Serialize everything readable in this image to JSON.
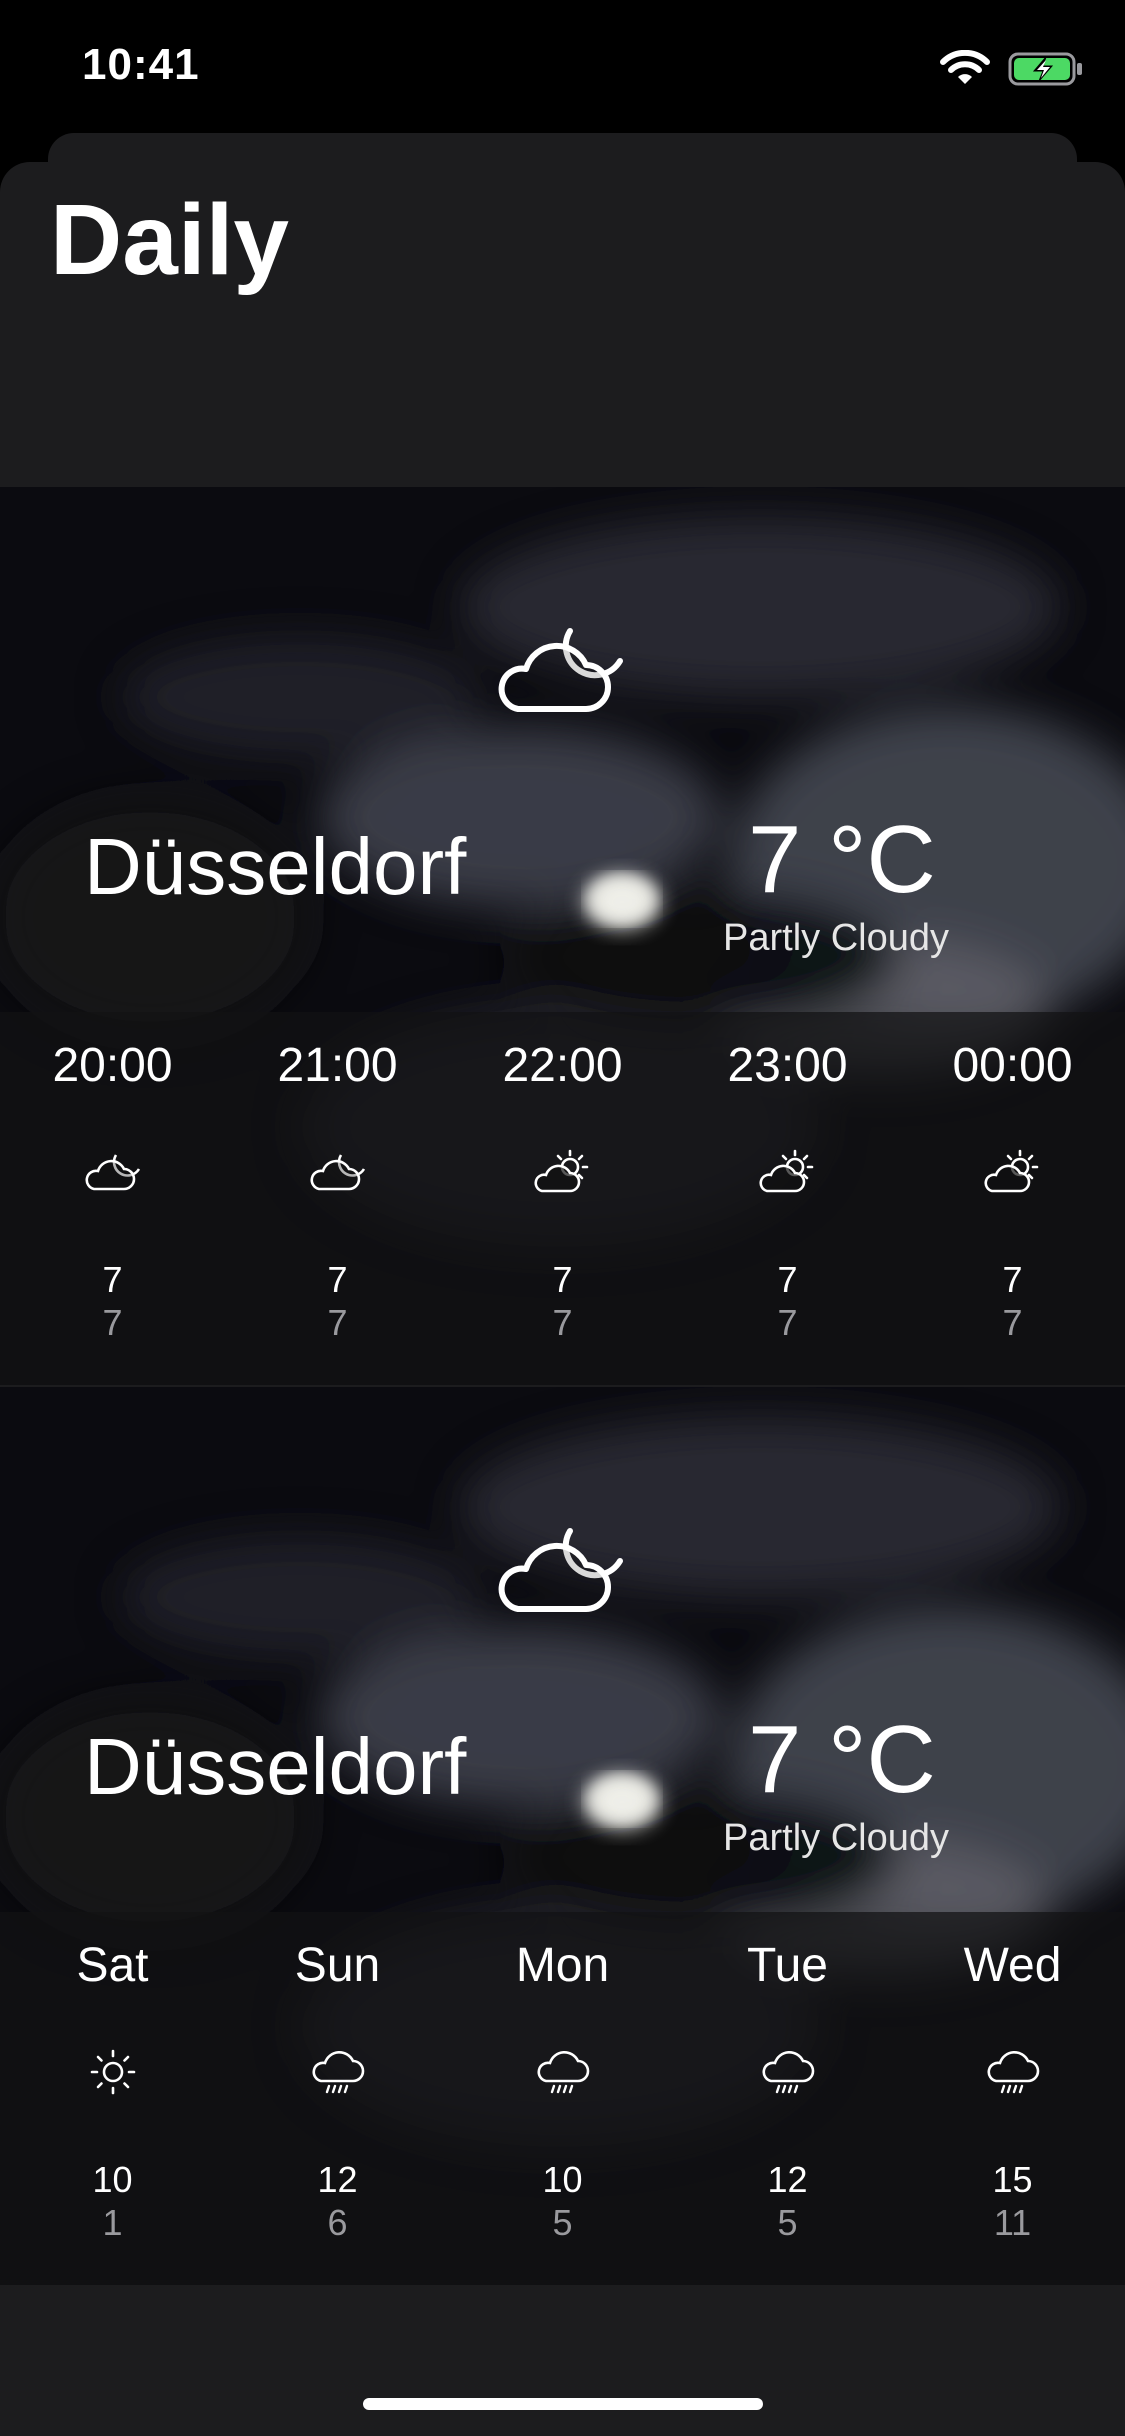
{
  "status_bar": {
    "time": "10:41"
  },
  "page": {
    "title": "Daily"
  },
  "current": {
    "city": "Düsseldorf",
    "temperature": "7 °C",
    "condition": "Partly Cloudy",
    "icon": "cloud-moon-icon"
  },
  "hourly": [
    {
      "label": "20:00",
      "icon": "cloud-moon-icon",
      "high": "7",
      "low": "7"
    },
    {
      "label": "21:00",
      "icon": "cloud-moon-icon",
      "high": "7",
      "low": "7"
    },
    {
      "label": "22:00",
      "icon": "cloud-sun-icon",
      "high": "7",
      "low": "7"
    },
    {
      "label": "23:00",
      "icon": "cloud-sun-icon",
      "high": "7",
      "low": "7"
    },
    {
      "label": "00:00",
      "icon": "cloud-sun-icon",
      "high": "7",
      "low": "7"
    }
  ],
  "daily": [
    {
      "label": "Sat",
      "icon": "sun-icon",
      "high": "10",
      "low": "1"
    },
    {
      "label": "Sun",
      "icon": "rain-cloud-icon",
      "high": "12",
      "low": "6"
    },
    {
      "label": "Mon",
      "icon": "rain-cloud-icon",
      "high": "10",
      "low": "5"
    },
    {
      "label": "Tue",
      "icon": "rain-cloud-icon",
      "high": "12",
      "low": "5"
    },
    {
      "label": "Wed",
      "icon": "rain-cloud-icon",
      "high": "15",
      "low": "11"
    }
  ],
  "colors": {
    "sheet": "#1c1c1e",
    "battery": "#4cd964",
    "low_temp": "#9a9a9e"
  }
}
